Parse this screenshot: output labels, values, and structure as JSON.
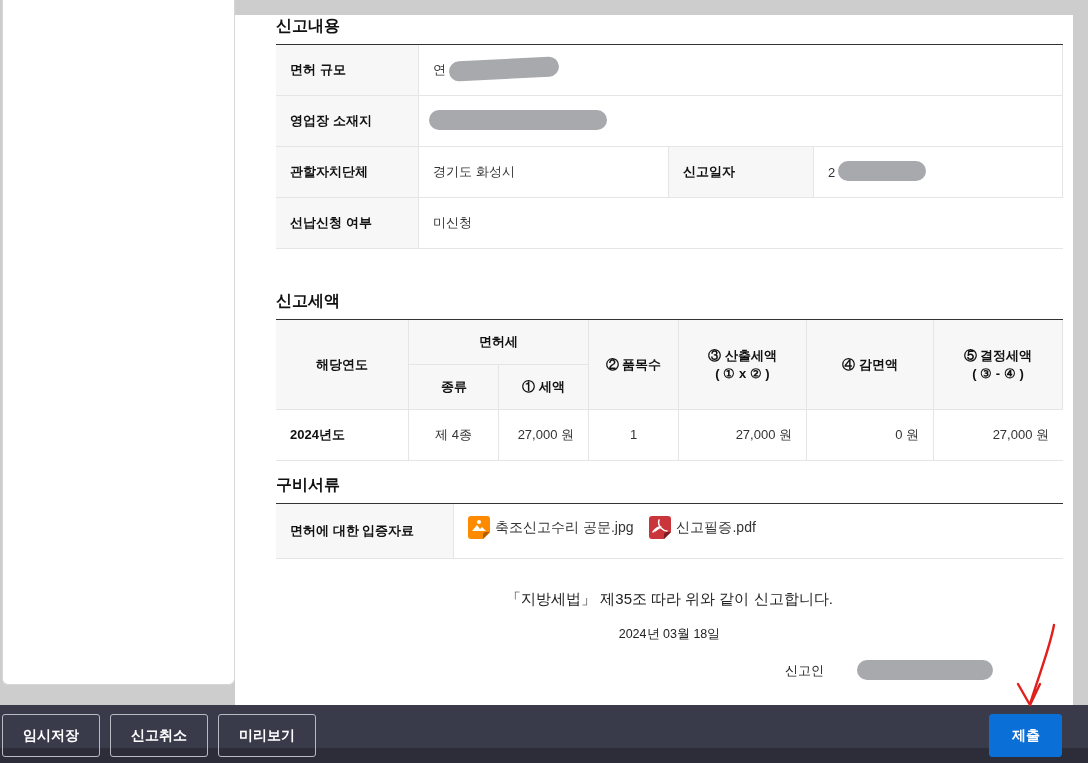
{
  "report_details": {
    "title": "신고내용",
    "rows": [
      {
        "cells": [
          {
            "label": "면허 규모",
            "value": "연",
            "redacted": true
          }
        ]
      },
      {
        "cells": [
          {
            "label": "영업장 소재지",
            "redacted": true
          }
        ]
      },
      {
        "cells": [
          {
            "label": "관할자치단체",
            "value": "경기도 화성시"
          },
          {
            "label": "신고일자",
            "value": "2",
            "redacted": true
          }
        ]
      },
      {
        "cells": [
          {
            "label": "선납신청 여부",
            "value": "미신청"
          }
        ]
      }
    ]
  },
  "tax_amount": {
    "title": "신고세액",
    "header": {
      "year": "해당연도",
      "license_tax": "면허세",
      "kind": "종류",
      "tax": "① 세액",
      "items": "② 품목수",
      "computed": "③ 산출세액\n( ① x ② )",
      "reduction": "④ 감면액",
      "final": "⑤ 결정세액\n( ③ - ④ )"
    },
    "rows": [
      {
        "year": "2024년도",
        "kind": "제 4종",
        "tax": "27,000 원",
        "items": "1",
        "computed": "27,000 원",
        "reduction": "0 원",
        "final": "27,000 원"
      }
    ]
  },
  "documents": {
    "title": "구비서류",
    "rows": [
      {
        "label": "면허에 대한 입증자료",
        "files": [
          {
            "kind": "image",
            "name": "축조신고수리 공문.jpg"
          },
          {
            "kind": "pdf",
            "name": "신고필증.pdf"
          }
        ]
      }
    ]
  },
  "declaration": {
    "statement": "「지방세법」 제35조 따라 위와 같이 신고합니다.",
    "date": "2024년 03월 18일",
    "reporter": {
      "label": "신고인",
      "redacted": true
    }
  },
  "actions": [
    {
      "label": "임시저장",
      "kind": "secondary"
    },
    {
      "label": "신고취소",
      "kind": "secondary"
    },
    {
      "label": "미리보기",
      "kind": "secondary"
    },
    {
      "label": "제출",
      "kind": "primary"
    }
  ]
}
